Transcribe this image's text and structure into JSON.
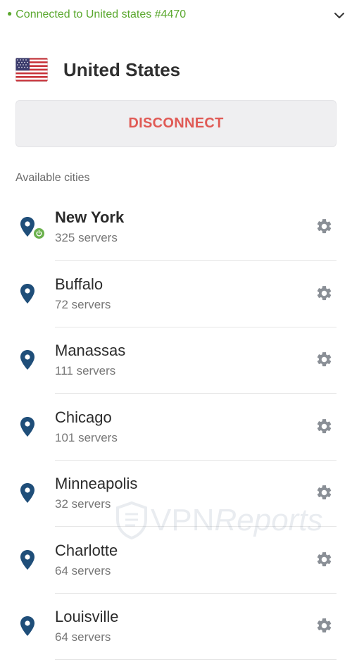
{
  "status": {
    "text": "Connected to United states #4470",
    "color": "#5aa82e",
    "expand_icon": "chevron-down-icon"
  },
  "country": {
    "name": "United States",
    "flag_icon": "us-flag-icon"
  },
  "actions": {
    "disconnect_label": "DISCONNECT"
  },
  "cities_section": {
    "label": "Available cities"
  },
  "cities": [
    {
      "name": "New York",
      "servers": "325 servers",
      "connected": true
    },
    {
      "name": "Buffalo",
      "servers": "72 servers",
      "connected": false
    },
    {
      "name": "Manassas",
      "servers": "111 servers",
      "connected": false
    },
    {
      "name": "Chicago",
      "servers": "101 servers",
      "connected": false
    },
    {
      "name": "Minneapolis",
      "servers": "32 servers",
      "connected": false
    },
    {
      "name": "Charlotte",
      "servers": "64 servers",
      "connected": false
    },
    {
      "name": "Louisville",
      "servers": "64 servers",
      "connected": false
    }
  ],
  "watermark": {
    "prefix": "VPN",
    "suffix": "Reports"
  },
  "colors": {
    "accent_green": "#5aa82e",
    "disconnect_red": "#e05a55",
    "pin_blue": "#1f4e79"
  }
}
